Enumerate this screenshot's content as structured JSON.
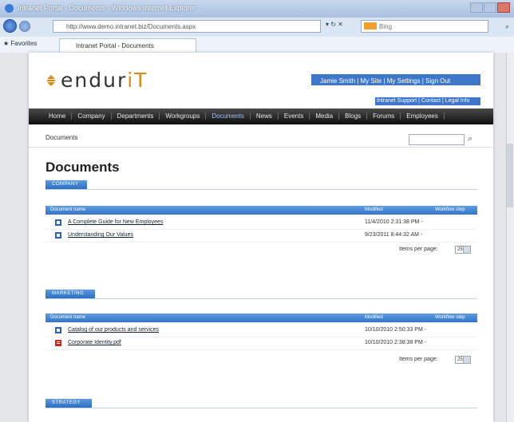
{
  "window": {
    "title": "Intranet Portal - Documents - Windows Internet Explorer",
    "url": "http://www.demo.intranet.biz/Documents.aspx",
    "search_engine": "Bing",
    "favorites_label": "Favorites",
    "tab_title": "Intranet Portal - Documents"
  },
  "header": {
    "logo_main": "endur",
    "logo_accent": "iT",
    "user_line": "Jamie Smith | My Site | My Settings | Sign Out",
    "user_links2": "Intranet Support | Contact | Legal Info",
    "accent_color": "#d88a1a"
  },
  "nav": {
    "items": [
      "Home",
      "Company",
      "Departments",
      "Workgroups",
      "Documents",
      "News",
      "Events",
      "Media",
      "Blogs",
      "Forums",
      "Employees"
    ],
    "active_index": 4
  },
  "breadcrumb": "Documents",
  "page": {
    "title": "Documents"
  },
  "sections": [
    {
      "label": "Company",
      "columns": {
        "name": "Document name",
        "modified": "Modified",
        "workflow": "Workflow step"
      },
      "rows": [
        {
          "name": "A Complete Guide for New Employees",
          "modified": "11/4/2010 2:31:38 PM",
          "workflow": "-",
          "icon": "word-doc-icon"
        },
        {
          "name": "Understanding Our Values",
          "modified": "9/23/2011 8:44:32 AM",
          "workflow": "-",
          "icon": "word-doc-icon"
        }
      ],
      "pager_label": "Items per page:",
      "pager_value": "25"
    },
    {
      "label": "Marketing",
      "columns": {
        "name": "Document name",
        "modified": "Modified",
        "workflow": "Workflow step"
      },
      "rows": [
        {
          "name": "Catalog of our products and services",
          "modified": "10/10/2010 2:50:33 PM",
          "workflow": "-",
          "icon": "word-doc-icon"
        },
        {
          "name": "Corporate Identity.pdf",
          "modified": "10/10/2010 2:38:38 PM",
          "workflow": "-",
          "icon": "pdf-icon"
        }
      ],
      "pager_label": "Items per page:",
      "pager_value": "25"
    },
    {
      "label": "Strategy"
    }
  ]
}
